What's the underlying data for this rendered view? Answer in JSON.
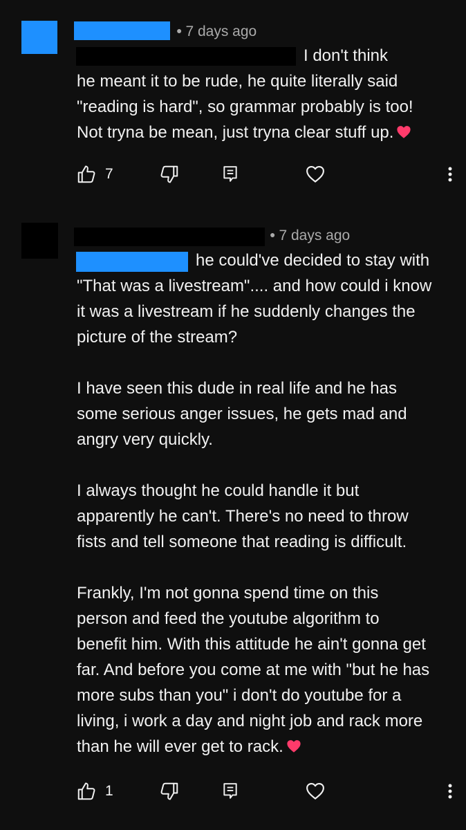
{
  "comments": [
    {
      "meta": "7 days ago",
      "body": "I don't think\nhe meant it to be rude, he quite literally said\n\"reading is hard\", so grammar probably is too!\nNot tryna be mean, just tryna clear stuff up.",
      "like_count": "7",
      "reaction_emoji": "heart"
    },
    {
      "meta": "7 days ago",
      "body": "he could've decided to stay with\n\"That was a livestream\".... and how could i know\nit was a livestream if he suddenly changes the\npicture of the stream?\n\nI have seen this dude in real life and he has\nsome serious anger issues, he gets mad and\nangry very quickly.\n\nI always thought he could handle it but\napparently he can't. There's no need to throw\nfists and tell someone that reading is difficult.\n\nFrankly, I'm not gonna spend time on this\nperson and feed the youtube algorithm to\nbenefit him. With this attitude he ain't gonna get\nfar. And before you come at me with \"but he has\nmore subs than you\" i don't do youtube for a\nliving, i work a day and night job and rack more\nthan he will ever get to rack.",
      "like_count": "1",
      "reaction_emoji": "heart"
    }
  ],
  "icons": {
    "like": "thumbs-up-icon",
    "dislike": "thumbs-down-icon",
    "reply": "reply-icon",
    "heart": "heart-icon",
    "more": "more-vert-icon"
  },
  "colors": {
    "background": "#0f0f0f",
    "text": "#f1f1f1",
    "meta": "#aaaaaa",
    "redaction_blue": "#1e90ff",
    "emoji_heart": "#ff3b6b"
  }
}
